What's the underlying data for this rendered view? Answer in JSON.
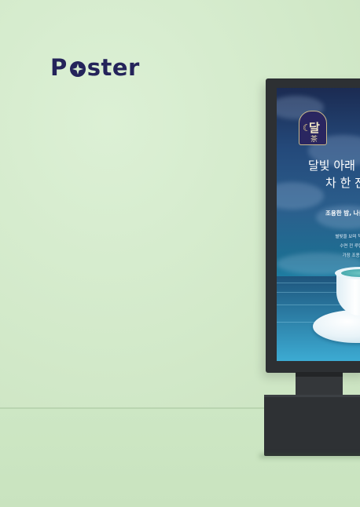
{
  "brand": {
    "title_p": "P",
    "title_rest": "ster"
  },
  "poster": {
    "logo_main": "달",
    "logo_sub": "茶",
    "headline_line1": "달빛 아래",
    "headline_line2": "차 한 잔",
    "subhead": "조용한 밤, 나를",
    "body_lines": [
      "별빛을 보며 책을 읽는 밤,",
      "수면 전 루틴, 조용한",
      "가장 조용한 시간,"
    ]
  },
  "colors": {
    "background": "#d6ecce",
    "brand": "#24235a",
    "kiosk": "#2d3033"
  }
}
